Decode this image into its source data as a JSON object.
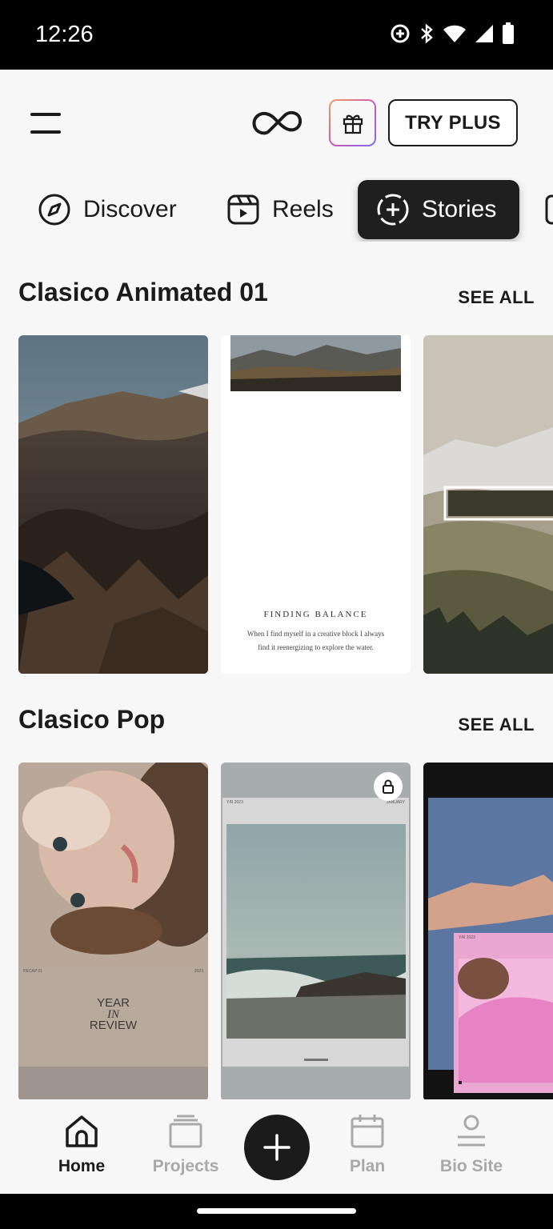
{
  "status_bar": {
    "time": "12:26"
  },
  "header": {
    "try_plus_label": "TRY PLUS"
  },
  "tabs": [
    {
      "label": "Discover",
      "icon": "compass-icon"
    },
    {
      "label": "Reels",
      "icon": "reels-icon"
    },
    {
      "label": "Stories",
      "icon": "stories-icon",
      "active": true
    }
  ],
  "sections": [
    {
      "title": "Clasico Animated 01",
      "see_all": "SEE ALL",
      "cards": [
        {
          "type": "landscape-mountain"
        },
        {
          "type": "text-story",
          "heading": "FINDING BALANCE",
          "body_line1": "When I find myself in a creative block I always",
          "body_line2": "find it reenergizing to explore the water."
        },
        {
          "type": "foggy-valley"
        }
      ]
    },
    {
      "title": "Clasico Pop",
      "see_all": "SEE ALL",
      "cards": [
        {
          "type": "year-in-review",
          "line1": "YEAR",
          "line2": "IN",
          "line3": "REVIEW",
          "small_left": "RECAP 01",
          "small_right": "2023"
        },
        {
          "type": "ocean-frame",
          "locked": true,
          "small_left": "Y/R 2023",
          "small_right": "JANUARY"
        },
        {
          "type": "pink-hoodie",
          "small_label": "Y/R 2023"
        }
      ]
    }
  ],
  "bottom_nav": [
    {
      "label": "Home",
      "icon": "home-icon",
      "active": true
    },
    {
      "label": "Projects",
      "icon": "projects-icon"
    },
    {
      "label": "Plan",
      "icon": "calendar-icon"
    },
    {
      "label": "Bio Site",
      "icon": "profile-icon"
    }
  ]
}
